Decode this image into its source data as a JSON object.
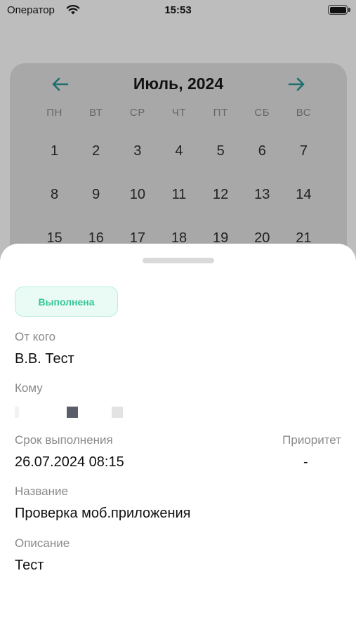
{
  "status_bar": {
    "carrier": "Оператор",
    "time": "15:53"
  },
  "calendar": {
    "title": "Июль, 2024",
    "accent_color": "#1f6f6f",
    "weekdays": [
      "ПН",
      "ВТ",
      "СР",
      "ЧТ",
      "ПТ",
      "СБ",
      "ВС"
    ],
    "weeks": [
      [
        "1",
        "2",
        "3",
        "4",
        "5",
        "6",
        "7"
      ],
      [
        "8",
        "9",
        "10",
        "11",
        "12",
        "13",
        "14"
      ],
      [
        "15",
        "16",
        "17",
        "18",
        "19",
        "20",
        "21"
      ]
    ],
    "prev_icon": "arrow-left-icon",
    "next_icon": "arrow-right-icon"
  },
  "task": {
    "status": "Выполнена",
    "status_color": "#35c797",
    "from_label": "От кого",
    "from_value": "В.В. Тест",
    "to_label": "Кому",
    "due_label": "Срок выполнения",
    "due_value": "26.07.2024 08:15",
    "priority_label": "Приоритет",
    "priority_value": "-",
    "name_label": "Название",
    "name_value": "Проверка моб.приложения",
    "description_label": "Описание",
    "description_value": "Тест"
  }
}
